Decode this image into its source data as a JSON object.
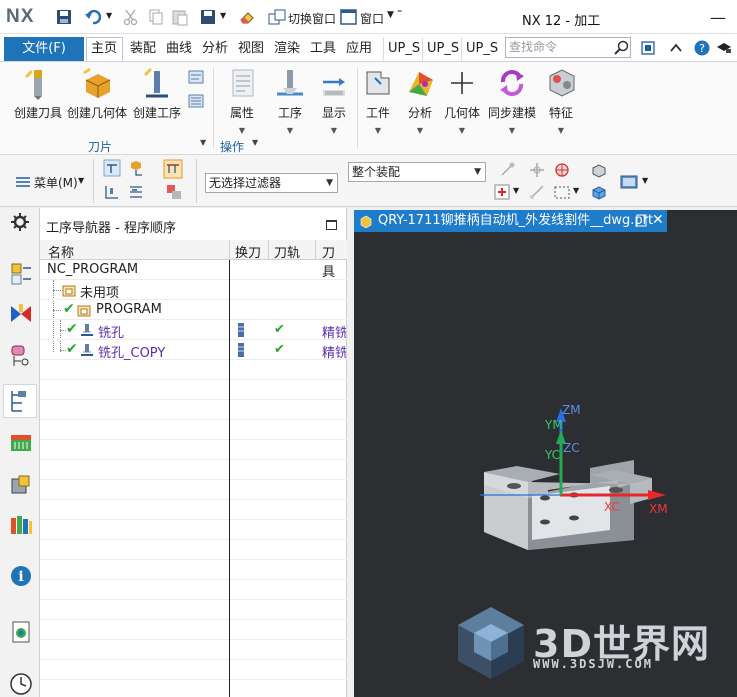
{
  "app": {
    "logo": "NX",
    "window_title": "NX 12 - 加工",
    "switch_window": "切换窗口",
    "window_menu": "窗口",
    "minimize": "—"
  },
  "tabs": [
    {
      "label": "文件(F)",
      "kind": "file"
    },
    {
      "label": "主页",
      "kind": "active"
    },
    {
      "label": "装配"
    },
    {
      "label": "曲线"
    },
    {
      "label": "分析"
    },
    {
      "label": "视图"
    },
    {
      "label": "渲染"
    },
    {
      "label": "工具"
    },
    {
      "label": "应用"
    },
    {
      "label": "UP_S",
      "kind": "trunc"
    },
    {
      "label": "UP_S",
      "kind": "trunc"
    },
    {
      "label": "UP_S",
      "kind": "trunc"
    }
  ],
  "search": {
    "placeholder": "查找命令"
  },
  "ribbon": {
    "buttons": [
      {
        "label": "创建刀具"
      },
      {
        "label": "创建几何体"
      },
      {
        "label": "创建工序"
      },
      {
        "label": "属性"
      },
      {
        "label": "工序"
      },
      {
        "label": "显示"
      },
      {
        "label": "工件"
      },
      {
        "label": "分析"
      },
      {
        "label": "几何体"
      },
      {
        "label": "同步建模"
      },
      {
        "label": "特征"
      }
    ],
    "groups": {
      "blade": "刀片",
      "operations": "操作"
    }
  },
  "toolbar": {
    "menu_label": "菜单(M)",
    "filter_value": "无选择过滤器",
    "assembly_value": "整个装配"
  },
  "navigator": {
    "title": "工序导航器 - 程序顺序",
    "columns": [
      "名称",
      "换刀",
      "刀轨",
      "刀具"
    ],
    "rows": [
      {
        "name": "NC_PROGRAM",
        "level": 0
      },
      {
        "name": "未用项",
        "level": 1
      },
      {
        "name": "PROGRAM",
        "level": 1
      },
      {
        "name": "铣孔",
        "level": 2,
        "tool_path": "✔",
        "tool": "精铣"
      },
      {
        "name": "铣孔_COPY",
        "level": 2,
        "tool_path": "✔",
        "tool": "精铣"
      }
    ]
  },
  "graphics": {
    "tab_title": "QRY-1711铆推柄自动机_外发线割件__dwg.prt",
    "axes": {
      "zm": "ZM",
      "ym": "YM",
      "zc": "ZC",
      "yc": "YC",
      "xc": "XC",
      "xm": "XM"
    },
    "watermark": {
      "text": "3D世界网",
      "url": "WWW.3DSJW.COM"
    }
  },
  "colors": {
    "accent": "#1f74b9",
    "tab_title_bg": "#1f7cc9",
    "viewport_bg": "#2c2e32",
    "axis_x": "#e8272b",
    "axis_y": "#22aa55",
    "axis_z": "#2a6ee0",
    "nav_purple": "#5a2da8"
  }
}
